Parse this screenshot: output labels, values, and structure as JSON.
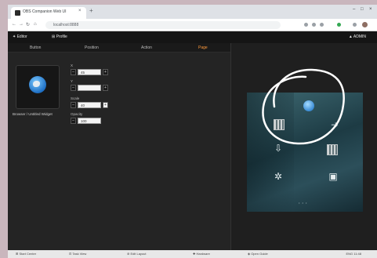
{
  "browser": {
    "tab_title": "OBS Companion Web UI",
    "tab_close": "×",
    "new_tab": "+",
    "window_controls": [
      "–",
      "□",
      "×"
    ],
    "nav": [
      "←",
      "→",
      "↻",
      "⌂"
    ],
    "url": "localhost:8888"
  },
  "app": {
    "header": {
      "brand": "✦ Editor",
      "section": "⊞ Profile",
      "user": "▲ ADMIN"
    },
    "tabs": [
      {
        "label": "Button",
        "active": false
      },
      {
        "label": "Position",
        "active": false
      },
      {
        "label": "Action",
        "active": false
      },
      {
        "label": "Page",
        "active": true
      }
    ],
    "icon_card": {
      "icon": "globe-icon",
      "caption": "Browser / Untitled Widget"
    },
    "fields": [
      {
        "label": "X",
        "value": "45",
        "dark": false
      },
      {
        "label": "Y",
        "value": "",
        "dark": false
      },
      {
        "label": "Scale",
        "value": "40",
        "dark": true
      },
      {
        "label": "Opacity",
        "value": "100",
        "dark": false
      }
    ],
    "preview": {
      "dots": "• • •"
    }
  },
  "taskbar": {
    "items": [
      "⊞ Start Center",
      "⊡ Task View",
      "⊚ Edit Layout",
      "✚ Hardware",
      "◈ Open Guide"
    ],
    "clock": "ENG 11:48"
  },
  "colors": {
    "accent": "#ff9a3c",
    "panel": "#242424",
    "header": "#151515"
  }
}
